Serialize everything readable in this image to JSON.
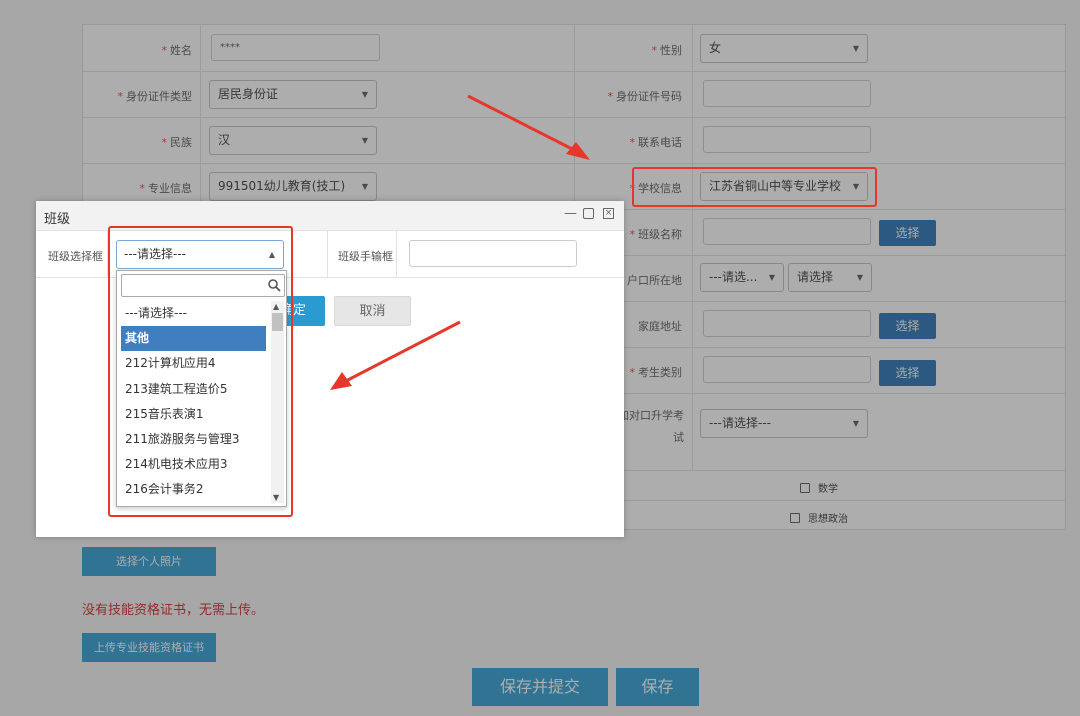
{
  "form": {
    "rows": [
      {
        "left_label": "姓名",
        "left_required": true,
        "left_value": "****",
        "right_label": "性别",
        "right_required": true,
        "right_value": "女"
      },
      {
        "left_label": "身份证件类型",
        "left_required": true,
        "left_value": "居民身份证",
        "right_label": "身份证件号码",
        "right_required": true,
        "right_value": ""
      },
      {
        "left_label": "民族",
        "left_required": true,
        "left_value": "汉",
        "right_label": "联系电话",
        "right_required": true,
        "right_value": ""
      },
      {
        "left_label": "专业信息",
        "left_required": true,
        "left_value": "991501幼儿教育(技工)",
        "right_label": "学校信息",
        "right_required": true,
        "right_value": "江苏省铜山中等专业学校"
      }
    ],
    "right_extra": [
      {
        "label": "班级名称",
        "required": true,
        "button": "选择"
      },
      {
        "label": "户口所在地",
        "required": false,
        "select1": "---请选...",
        "select2": "请选择"
      },
      {
        "label": "家庭地址",
        "required": false,
        "button": "选择"
      },
      {
        "label": "考生类别",
        "required": true,
        "button": "选择"
      },
      {
        "label": "加对口升学考试",
        "required": false,
        "select": "---请选择---"
      }
    ],
    "subjects": [
      "数学",
      "思想政治"
    ]
  },
  "buttons": {
    "photo": "选择个人照片",
    "cert": "上传专业技能资格证书",
    "submit": "保存并提交",
    "save": "保存"
  },
  "note": "没有技能资格证书，无需上传。",
  "modal": {
    "title": "班级",
    "select_label": "班级选择框",
    "select_value": "---请选择---",
    "input_label": "班级手输框",
    "ok": "确定",
    "cancel": "取消"
  },
  "dropdown": {
    "options": [
      "---请选择---",
      "其他",
      "212计算机应用4",
      "213建筑工程造价5",
      "215音乐表演1",
      "211旅游服务与管理3",
      "214机电技术应用3",
      "216会计事务2"
    ],
    "selected_index": 1
  },
  "colors": {
    "primary": "#2a9bd1",
    "button_dark": "#1f6fb5",
    "required": "#e23b3b",
    "annotation": "#e5372a"
  }
}
